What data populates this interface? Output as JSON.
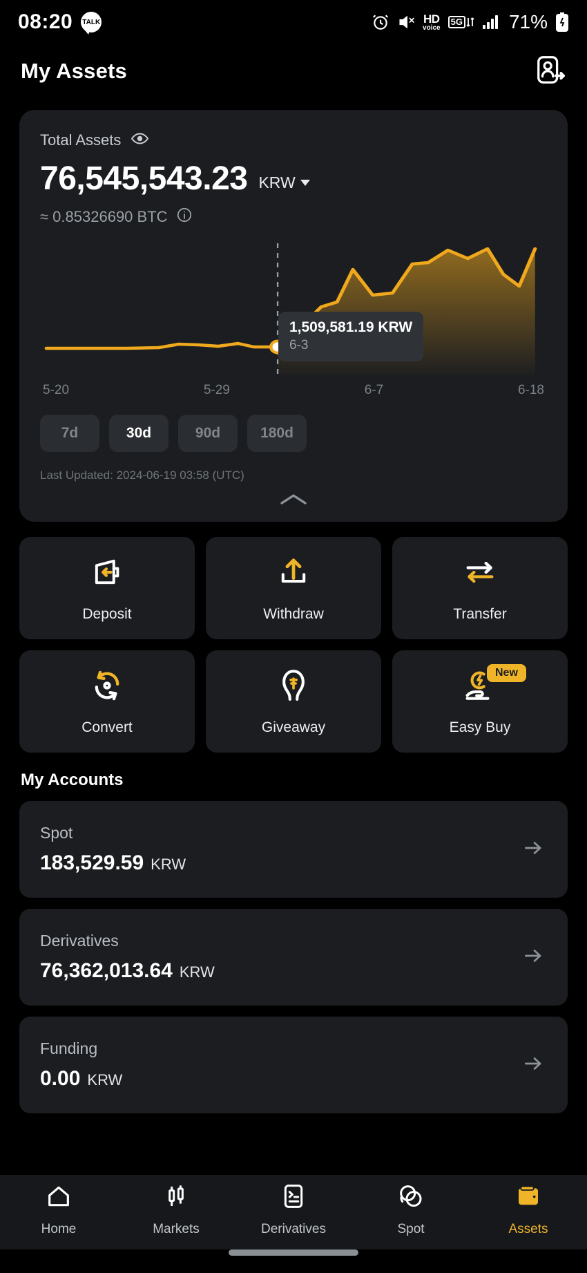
{
  "status_bar": {
    "time": "08:20",
    "talk_icon_label": "TALK",
    "icons": [
      "alarm-icon",
      "mute-icon",
      "hd-voice-icon",
      "5g-icon",
      "signal-icon"
    ],
    "hd_top": "HD",
    "hd_bottom": "voice",
    "network": "5G",
    "battery_percent": "71%"
  },
  "header": {
    "title": "My Assets",
    "action_icon": "user-transfer-icon"
  },
  "balance": {
    "total_label": "Total Assets",
    "eye_icon": "eye-icon",
    "amount": "76,545,543.23",
    "currency": "KRW",
    "btc_equivalent": "≈ 0.85326690 BTC",
    "info_icon": "info-icon"
  },
  "chart_data": {
    "type": "area",
    "title": "Total Assets trend",
    "xlabel": "",
    "ylabel": "KRW",
    "grid": false,
    "legend": null,
    "line_color": "#f0a91e",
    "tick_labels": [
      "5-20",
      "5-29",
      "6-7",
      "6-18"
    ],
    "highlight": {
      "value_label": "1,509,581.19 KRW",
      "date_label": "6-3",
      "x_index": 14
    },
    "x": [
      "5-20",
      "5-21",
      "5-22",
      "5-23",
      "5-24",
      "5-25",
      "5-26",
      "5-27",
      "5-28",
      "5-29",
      "5-30",
      "5-31",
      "6-1",
      "6-2",
      "6-3",
      "6-4",
      "6-5",
      "6-6",
      "6-7",
      "6-8",
      "6-9",
      "6-10",
      "6-11",
      "6-12",
      "6-13",
      "6-14",
      "6-15",
      "6-16",
      "6-17",
      "6-18"
    ],
    "values": [
      1300000,
      1300000,
      1300000,
      1300000,
      1300000,
      1300000,
      1300000,
      1300000,
      1380000,
      1400000,
      1420000,
      1450000,
      1470000,
      1430000,
      1509581,
      2300000,
      3000000,
      3150000,
      4900000,
      3600000,
      3700000,
      5150000,
      5200000,
      5900000,
      5500000,
      6400000,
      5600000,
      4800000,
      7400000,
      8100000
    ]
  },
  "ranges": {
    "options": [
      "7d",
      "30d",
      "90d",
      "180d"
    ],
    "selected": "30d"
  },
  "last_updated": "Last Updated: 2024-06-19 03:58 (UTC)",
  "collapse_icon": "chevron-up-icon",
  "actions": [
    {
      "label": "Deposit",
      "icon": "deposit-icon",
      "badge": null
    },
    {
      "label": "Withdraw",
      "icon": "withdraw-icon",
      "badge": null
    },
    {
      "label": "Transfer",
      "icon": "transfer-icon",
      "badge": null
    },
    {
      "label": "Convert",
      "icon": "convert-icon",
      "badge": null
    },
    {
      "label": "Giveaway",
      "icon": "giveaway-icon",
      "badge": null
    },
    {
      "label": "Easy Buy",
      "icon": "easy-buy-icon",
      "badge": "New"
    }
  ],
  "accounts_section": {
    "title": "My Accounts",
    "items": [
      {
        "name": "Spot",
        "amount": "183,529.59",
        "currency": "KRW"
      },
      {
        "name": "Derivatives",
        "amount": "76,362,013.64",
        "currency": "KRW"
      },
      {
        "name": "Funding",
        "amount": "0.00",
        "currency": "KRW"
      }
    ]
  },
  "bottom_nav": {
    "items": [
      {
        "label": "Home",
        "icon": "home-icon",
        "active": false
      },
      {
        "label": "Markets",
        "icon": "candlestick-icon",
        "active": false
      },
      {
        "label": "Derivatives",
        "icon": "contract-icon",
        "active": false
      },
      {
        "label": "Spot",
        "icon": "swap-circle-icon",
        "active": false
      },
      {
        "label": "Assets",
        "icon": "wallet-icon",
        "active": true
      }
    ]
  },
  "colors": {
    "accent": "#f0b429",
    "chart_line": "#f0a91e",
    "card_bg": "#1b1d20",
    "page_bg": "#000000"
  }
}
